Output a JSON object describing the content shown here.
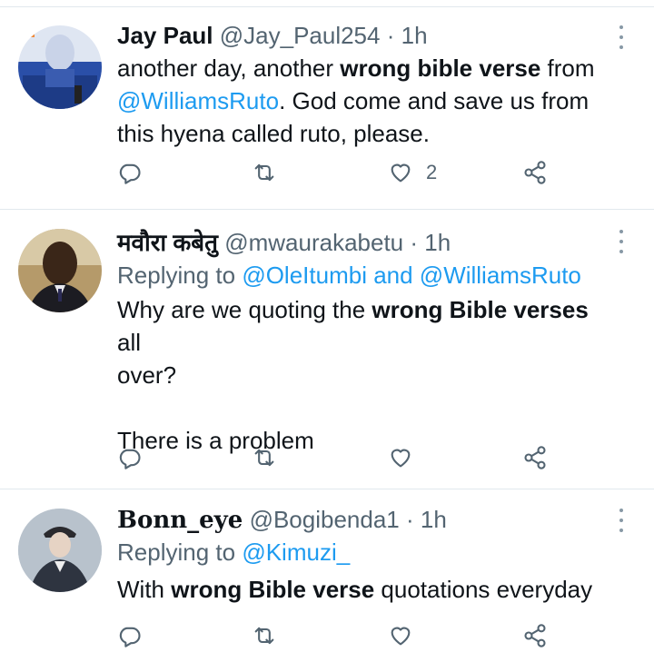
{
  "tweets": [
    {
      "name": "Jay Paul",
      "handle": "@Jay_Paul254",
      "dot": "·",
      "time": "1h",
      "replying": null,
      "text_parts": [
        {
          "t": "another day, another "
        },
        {
          "t": "wrong bible verse",
          "b": true
        },
        {
          "t": " from\n"
        },
        {
          "t": "@WilliamsRuto",
          "m": true
        },
        {
          "t": ". God come and save us from\nthis hyena called ruto, please."
        }
      ],
      "actions": {
        "reply_count": "",
        "retweet_count": "",
        "like_count": "2"
      }
    },
    {
      "name": "मवौरा कबेतु",
      "handle": "@mwaurakabetu",
      "dot": "·",
      "time": "1h",
      "replying": {
        "prefix": "Replying to ",
        "first": "@OleItumbi",
        "joiner": " and ",
        "second": "@WilliamsRuto"
      },
      "text_parts": [
        {
          "t": "Why are we quoting the "
        },
        {
          "t": "wrong Bible verses",
          "b": true
        },
        {
          "t": " all\nover?\n\nThere is a problem"
        }
      ],
      "actions": {
        "reply_count": "",
        "retweet_count": "",
        "like_count": ""
      }
    },
    {
      "name": "Bonn_eye",
      "handle": "@Bogibenda1",
      "dot": "·",
      "time": "1h",
      "replying": {
        "prefix": "Replying to ",
        "first": "@Kimuzi_",
        "joiner": "",
        "second": ""
      },
      "text_parts": [
        {
          "t": "With "
        },
        {
          "t": "wrong Bible verse",
          "b": true
        },
        {
          "t": " quotations everyday"
        }
      ],
      "actions": {
        "reply_count": "",
        "retweet_count": "",
        "like_count": ""
      }
    }
  ],
  "icons": {
    "reply": "reply-icon",
    "retweet": "retweet-icon",
    "like": "heart-icon",
    "share": "share-icon",
    "more": "more-options-icon"
  },
  "colors": {
    "link": "#1d9bf0",
    "secondary": "#536471",
    "divider": "#e1e8ed"
  }
}
